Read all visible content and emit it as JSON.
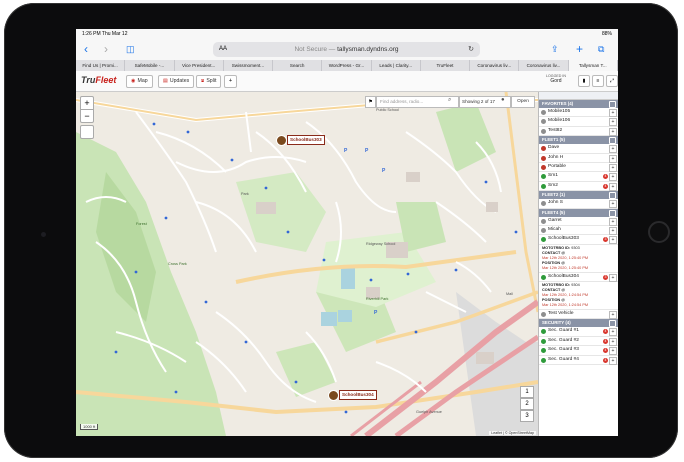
{
  "status": {
    "time_date": "1:26 PM  Thu Mar 12",
    "battery": "88%"
  },
  "browser": {
    "url_prefix": "Not Secure —",
    "url": "tallysman.dyndns.org",
    "aa": "AA",
    "tabs": [
      "Find Us | Promi...",
      "SafeMobile -...",
      "Vice President...",
      "Swissmoment...",
      "Search",
      "WordPress - Gr...",
      "Leads | Clarity...",
      "TruFleet",
      "Coronavirus liv...",
      "Coronavirus liv...",
      "Tallysman T..."
    ]
  },
  "app": {
    "logo_main": "Tru",
    "logo_accent": "Fleet",
    "map_btn": "Map",
    "updates_btn": "Updates",
    "split_btn": "Split",
    "add_btn": "+",
    "logged_in_label": "LOGGED IN",
    "logged_in_user": "Gord"
  },
  "map": {
    "search_placeholder": "Find address, radio...",
    "showing": "Showing 2 of 17",
    "open_btn": "Open",
    "bus1": "SchoolBus303",
    "bus2": "SchoolBus304",
    "scale": "1000 ft",
    "attribution": "Leaflet | © OpenStreetMap",
    "zoom_in": "+",
    "zoom_out": "−",
    "labels": {
      "school": "Public School",
      "ridge": "Ridgeway School",
      "park": "Park",
      "heart": "Cross Park",
      "forest": "Forest",
      "hill": "Riverhill Park",
      "mall": "Mall",
      "guelph": "Guelph Avenue"
    }
  },
  "panel": {
    "groups": [
      {
        "title": "FAVORITES (4)",
        "rows": [
          {
            "name": "Mobile105",
            "color": "gray",
            "badge": ""
          },
          {
            "name": "Mobile106",
            "color": "gray",
            "badge": ""
          },
          {
            "name": "Test82",
            "color": "gray",
            "badge": ""
          }
        ]
      },
      {
        "title": "FLEET1 (5)",
        "rows": [
          {
            "name": "Dave",
            "color": "red",
            "badge": ""
          },
          {
            "name": "John H",
            "color": "red",
            "badge": ""
          },
          {
            "name": "Portable",
            "color": "red",
            "badge": ""
          },
          {
            "name": "Sm1",
            "color": "green",
            "badge": "4"
          },
          {
            "name": "Sm2",
            "color": "green",
            "badge": "4"
          }
        ]
      },
      {
        "title": "FLEET2 (1)",
        "rows": [
          {
            "name": "John S",
            "color": "gray",
            "badge": ""
          }
        ]
      },
      {
        "title": "FLEET4 (5)",
        "rows": [
          {
            "name": "Garret",
            "color": "gray",
            "badge": ""
          },
          {
            "name": "Micah",
            "color": "gray",
            "badge": ""
          },
          {
            "name": "SchoolBus303",
            "color": "green",
            "badge": "3"
          }
        ]
      }
    ],
    "bus303_details": {
      "radio_id_label": "MOTOTRBO ID:",
      "radio_id": "9303",
      "contact_label": "CONTACT @",
      "contact": "Mar 12th 2020, 1:25:40 PM",
      "position_label": "POSITION @",
      "position": "Mar 12th 2020, 1:25:40 PM"
    },
    "bus304": {
      "name": "SchoolBus304",
      "badge": "3"
    },
    "bus304_details": {
      "radio_id_label": "MOTOTRBO ID:",
      "radio_id": "9304",
      "contact_label": "CONTACT @",
      "contact": "Mar 12th 2020, 1:24:54 PM",
      "position_label": "POSITION @",
      "position": "Mar 12th 2020, 1:24:54 PM"
    },
    "test_vehicle": "Test Vehicle",
    "security_title": "SECURITY (4)",
    "security_rows": [
      {
        "name": "Sec. Guard #1",
        "badge": "4"
      },
      {
        "name": "Sec. Guard #2",
        "badge": "4"
      },
      {
        "name": "Sec. Guard #3",
        "badge": "4"
      },
      {
        "name": "Sec. Guard #4",
        "badge": "4"
      }
    ]
  },
  "colors": {
    "accent": "#c8211c",
    "online": "#2f9b3b",
    "offline": "#c0392b"
  }
}
